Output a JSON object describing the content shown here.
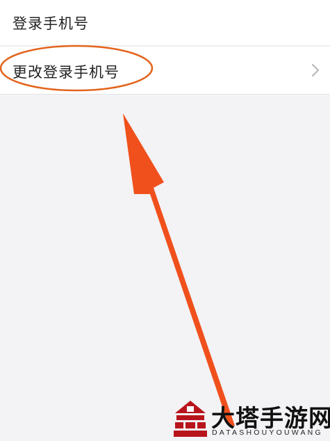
{
  "settings": {
    "rows": [
      {
        "label": "登录手机号"
      },
      {
        "label": "更改登录手机号",
        "icon": "chevron-right-icon"
      }
    ]
  },
  "annotation": {
    "color": "#f0501c",
    "highlight": "ellipse-highlight",
    "pointer": "arrow-pointer"
  },
  "watermark": {
    "title": "大塔手游网",
    "subtitle": "DATASHOUYOUWANG",
    "logo_color": "#b8141c"
  }
}
